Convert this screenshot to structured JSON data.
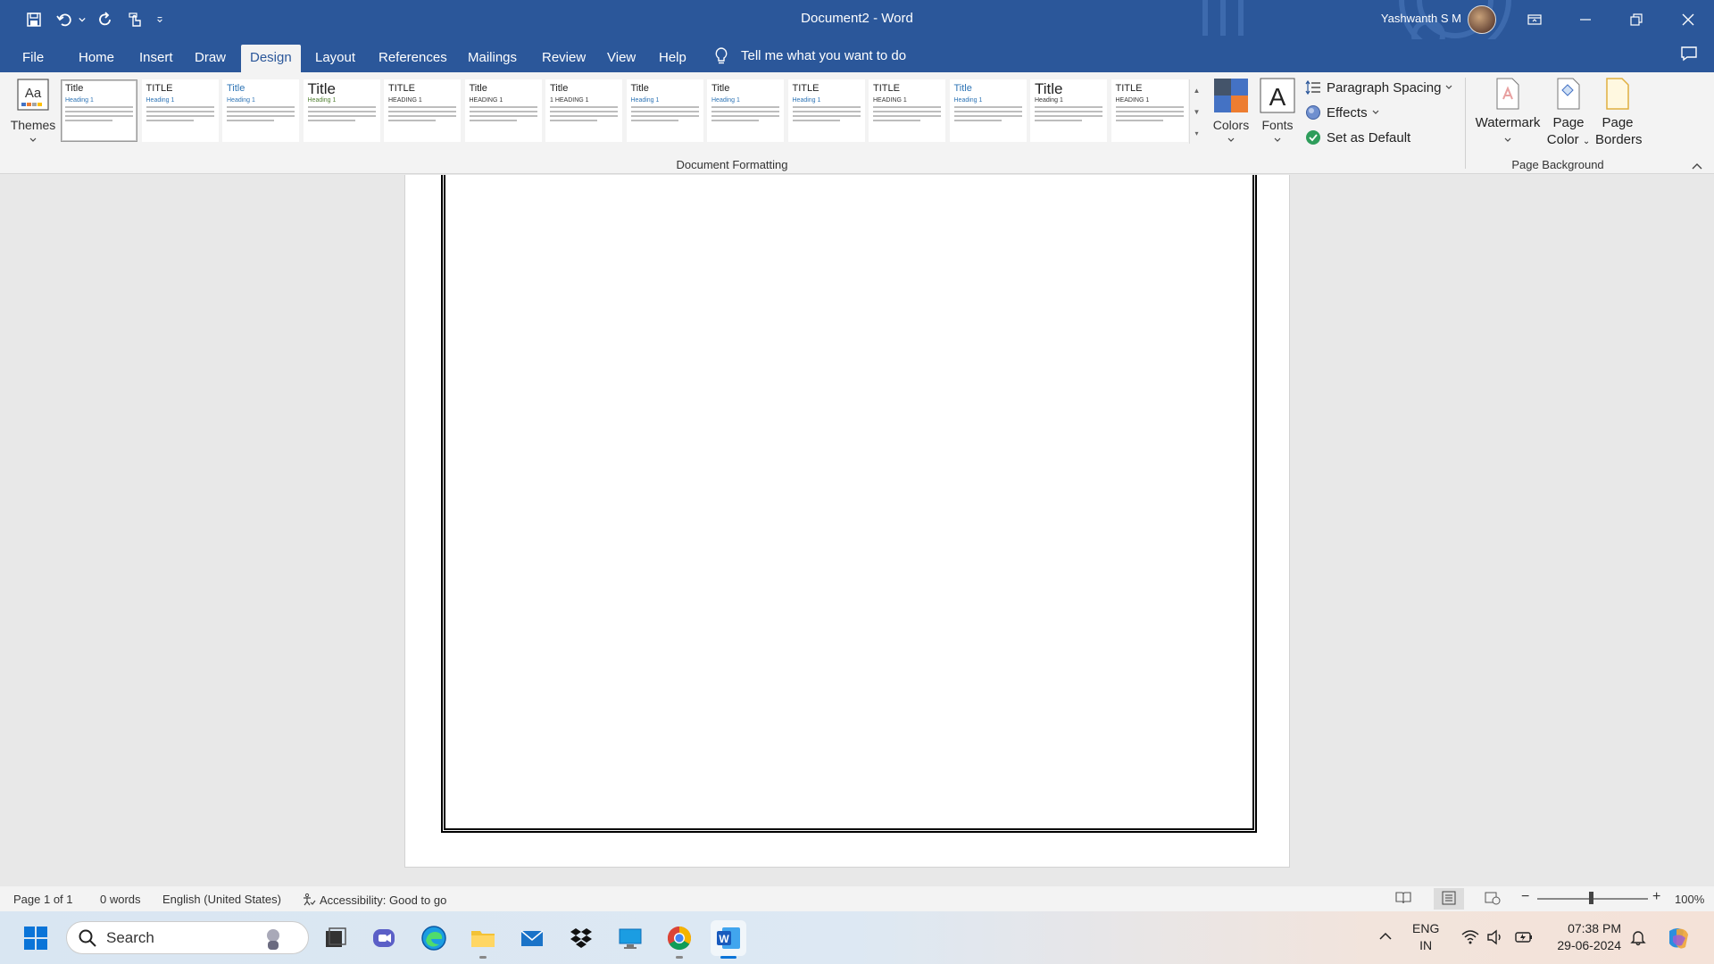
{
  "titlebar": {
    "document_name": "Document2",
    "separator": "-",
    "app_name": "Word",
    "user_name": "Yashwanth S M",
    "bg_color": "#2b579a"
  },
  "quick_access": {
    "icons": [
      "save-icon",
      "undo-icon",
      "undo-dropdown-icon",
      "redo-icon",
      "touch-mode-icon",
      "customize-qat-icon"
    ]
  },
  "menu": {
    "tabs": [
      {
        "label": "File"
      },
      {
        "label": "Home"
      },
      {
        "label": "Insert"
      },
      {
        "label": "Draw"
      },
      {
        "label": "Design"
      },
      {
        "label": "Layout"
      },
      {
        "label": "References"
      },
      {
        "label": "Mailings"
      },
      {
        "label": "Review"
      },
      {
        "label": "View"
      },
      {
        "label": "Help"
      }
    ],
    "active_tab": "Design",
    "tell_me": "Tell me what you want to do"
  },
  "ribbon": {
    "themes_label": "Themes",
    "gallery_styles": [
      {
        "title": "Title",
        "heading": "Heading 1"
      },
      {
        "title": "TITLE",
        "heading": "Heading 1"
      },
      {
        "title": "Title",
        "heading": "Heading 1"
      },
      {
        "title": "Title",
        "heading": "Heading 1"
      },
      {
        "title": "TITLE",
        "heading": "HEADING 1"
      },
      {
        "title": "Title",
        "heading": "HEADING 1"
      },
      {
        "title": "Title",
        "heading": "1 HEADING 1"
      },
      {
        "title": "Title",
        "heading": "Heading 1"
      },
      {
        "title": "Title",
        "heading": "Heading 1"
      },
      {
        "title": "TITLE",
        "heading": "Heading 1"
      },
      {
        "title": "TITLE",
        "heading": "HEADING 1"
      },
      {
        "title": "Title",
        "heading": "Heading 1"
      },
      {
        "title": "Title",
        "heading": "Heading 1"
      },
      {
        "title": "TITLE",
        "heading": "HEADING 1"
      }
    ],
    "document_formatting_label": "Document Formatting",
    "colors_label": "Colors",
    "fonts_label": "Fonts",
    "paragraph_spacing_label": "Paragraph Spacing",
    "effects_label": "Effects",
    "set_as_default_label": "Set as Default",
    "watermark_label": "Watermark",
    "page_color_label_1": "Page",
    "page_color_label_2": "Color",
    "page_borders_label_1": "Page",
    "page_borders_label_2": "Borders",
    "page_background_label": "Page Background"
  },
  "statusbar": {
    "page": "Page 1 of 1",
    "words": "0 words",
    "language": "English (United States)",
    "accessibility": "Accessibility: Good to go",
    "zoom": "100%",
    "zoom_minus": "−",
    "zoom_plus": "+"
  },
  "taskbar": {
    "search_placeholder": "Search",
    "apps": [
      "windows-start",
      "search",
      "task-view",
      "teams",
      "edge",
      "file-explorer",
      "mail",
      "dropbox",
      "remote-desktop",
      "chrome",
      "word"
    ],
    "language_1": "ENG",
    "language_2": "IN",
    "time": "07:38 PM",
    "date": "29-06-2024"
  }
}
